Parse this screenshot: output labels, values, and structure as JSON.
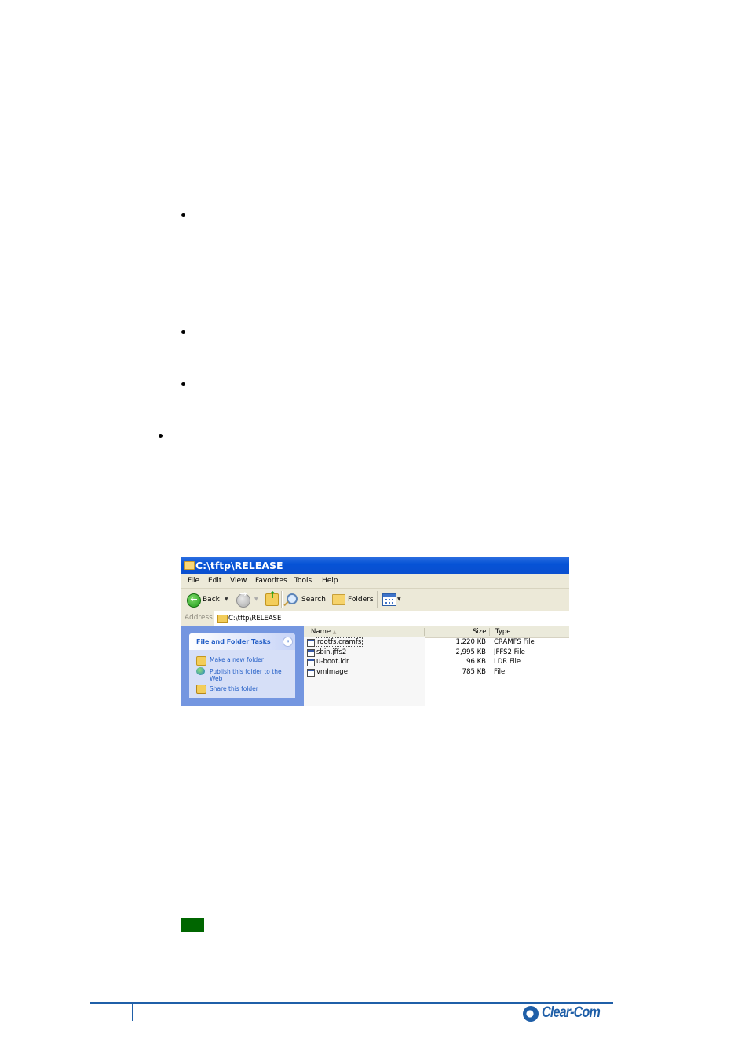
{
  "document": {
    "bullets_count": 4
  },
  "window": {
    "title": "C:\\tftp\\RELEASE",
    "menu": [
      "File",
      "Edit",
      "View",
      "Favorites",
      "Tools",
      "Help"
    ],
    "toolbar": {
      "back_label": "Back",
      "search_label": "Search",
      "folders_label": "Folders"
    },
    "address": {
      "label": "Address",
      "value": "C:\\tftp\\RELEASE"
    },
    "task_pane": {
      "title": "File and Folder Tasks",
      "collapse_glyph": "«",
      "items": [
        {
          "label": "Make a new folder",
          "icon": "new-folder-icon"
        },
        {
          "label": "Publish this folder to the Web",
          "icon": "publish-web-icon"
        },
        {
          "label": "Share this folder",
          "icon": "share-folder-icon"
        }
      ]
    },
    "columns": {
      "name": "Name",
      "size": "Size",
      "type": "Type",
      "sort_arrow": "▲"
    },
    "files": [
      {
        "name": "rootfs.cramfs",
        "size": "1,220 KB",
        "type": "CRAMFS File",
        "focused": true
      },
      {
        "name": "sbin.jffs2",
        "size": "2,995 KB",
        "type": "JFFS2 File",
        "focused": false
      },
      {
        "name": "u-boot.ldr",
        "size": "96 KB",
        "type": "LDR File",
        "focused": false
      },
      {
        "name": "vmImage",
        "size": "785 KB",
        "type": "File",
        "focused": false
      }
    ]
  },
  "colors": {
    "title_bar": "#0a4fd0",
    "task_link": "#215dc6",
    "note_marker": "#006600",
    "footer_brand": "#1f5fa8"
  },
  "footer": {
    "logo_text": "Clear-Com"
  }
}
